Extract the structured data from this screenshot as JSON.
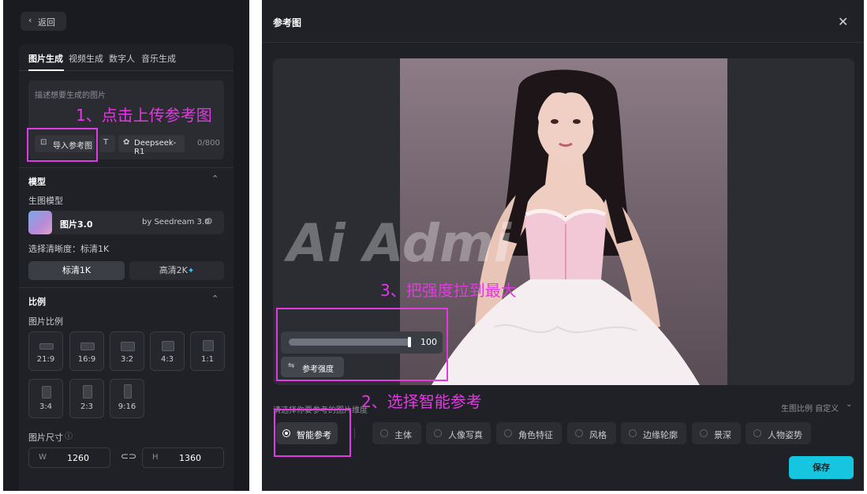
{
  "left_panel": {
    "back_label": "返回",
    "tabs": [
      "图片生成",
      "视频生成",
      "数字人",
      "音乐生成"
    ],
    "prompt_placeholder": "描述想要生成的图片",
    "import_ref_label": "导入参考图",
    "model_chip_label": "Deepseek-R1",
    "char_count": "0/800",
    "model_section_title": "模型",
    "gen_model_label": "生图模型",
    "model_name": "图片3.0",
    "model_by": "by Seedream 3.0",
    "clarity_label": "选择清晰度：标清1K",
    "clarity_options": [
      "标清1K",
      "高清2K"
    ],
    "ratio_section_title": "比例",
    "ratio_label": "图片比例",
    "ratios_row1": [
      "21:9",
      "16:9",
      "3:2",
      "4:3",
      "1:1"
    ],
    "ratios_row2": [
      "3:4",
      "2:3",
      "9:16"
    ],
    "size_label": "图片尺寸",
    "width_label": "W",
    "width_value": "1260",
    "height_label": "H",
    "height_value": "1360"
  },
  "dialog": {
    "title": "参考图",
    "watermark": "Ai Admi",
    "slider_value": "100",
    "slider_fraction": 1.0,
    "strength_label": "参考强度",
    "select_prompt": "请选择你要参考的图片维度",
    "ratio_dropdown": "生图比例 自定义",
    "options": [
      "智能参考",
      "主体",
      "人像写真",
      "角色特征",
      "风格",
      "边缘轮廓",
      "景深",
      "人物姿势"
    ],
    "save_label": "保存"
  },
  "annotations": {
    "step1": "1、点击上传参考图",
    "step2": "2、选择智能参考",
    "step3": "3、把强度拉到最大"
  },
  "colors": {
    "accent_magenta": "#e03ae0",
    "save_cyan": "#16c6e0"
  }
}
